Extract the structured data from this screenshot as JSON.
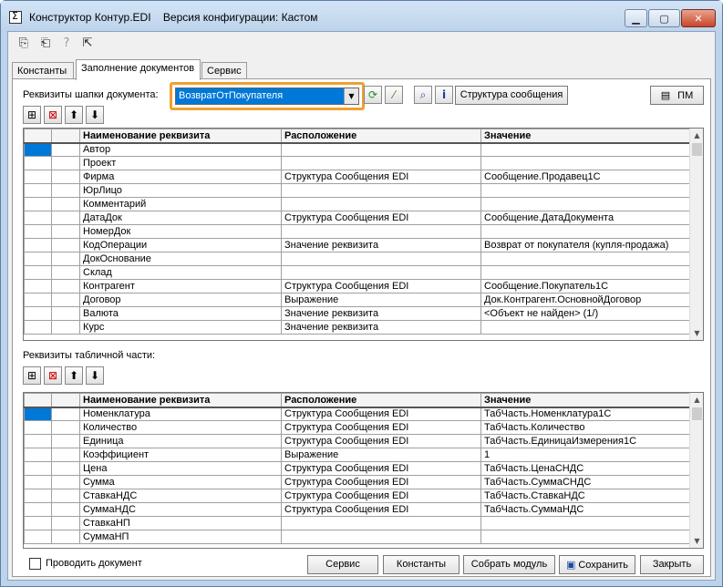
{
  "window": {
    "title": "Конструктор Контур.EDI    Версия конфигурации: Кастом"
  },
  "tabs": [
    {
      "label": "Константы"
    },
    {
      "label": "Заполнение документов"
    },
    {
      "label": "Сервис"
    }
  ],
  "header_section": {
    "label": "Реквизиты шапки документа:",
    "combo_value": "ВозвратОтПокупателя",
    "structure_button": "Структура сообщения",
    "pm_button": "ПМ",
    "columns": [
      "Наименование реквизита",
      "Расположение",
      "Значение"
    ],
    "rows": [
      [
        "Автор",
        "",
        ""
      ],
      [
        "Проект",
        "",
        ""
      ],
      [
        "Фирма",
        "Структура Сообщения EDI",
        "Сообщение.Продавец1С"
      ],
      [
        "ЮрЛицо",
        "",
        ""
      ],
      [
        "Комментарий",
        "",
        ""
      ],
      [
        "ДатаДок",
        "Структура Сообщения EDI",
        "Сообщение.ДатаДокумента"
      ],
      [
        "НомерДок",
        "",
        ""
      ],
      [
        "КодОперации",
        "Значение реквизита",
        "Возврат от покупателя (купля-продажа)"
      ],
      [
        "ДокОснование",
        "",
        ""
      ],
      [
        "Склад",
        "",
        ""
      ],
      [
        "Контрагент",
        "Структура Сообщения EDI",
        "Сообщение.Покупатель1С"
      ],
      [
        "Договор",
        "Выражение",
        "Док.Контрагент.ОсновнойДоговор"
      ],
      [
        "Валюта",
        "Значение реквизита",
        "<Объект не найден> (1/)"
      ],
      [
        "Курс",
        "Значение реквизита",
        ""
      ]
    ]
  },
  "table_section": {
    "label": "Реквизиты табличной части:",
    "columns": [
      "Наименование реквизита",
      "Расположение",
      "Значение"
    ],
    "rows": [
      [
        "Номенклатура",
        "Структура Сообщения EDI",
        "ТабЧасть.Номенклатура1С"
      ],
      [
        "Количество",
        "Структура Сообщения EDI",
        "ТабЧасть.Количество"
      ],
      [
        "Единица",
        "Структура Сообщения EDI",
        "ТабЧасть.ЕдиницаИзмерения1С"
      ],
      [
        "Коэффициент",
        "Выражение",
        "1"
      ],
      [
        "Цена",
        "Структура Сообщения EDI",
        "ТабЧасть.ЦенаСНДС"
      ],
      [
        "Сумма",
        "Структура Сообщения EDI",
        "ТабЧасть.СуммаСНДС"
      ],
      [
        "СтавкаНДС",
        "Структура Сообщения EDI",
        "ТабЧасть.СтавкаНДС"
      ],
      [
        "СуммаНДС",
        "Структура Сообщения EDI",
        "ТабЧасть.СуммаНДС"
      ],
      [
        "СтавкаНП",
        "",
        ""
      ],
      [
        "СуммаНП",
        "",
        ""
      ]
    ]
  },
  "footer": {
    "checkbox_label": "Проводить документ",
    "buttons": [
      "Сервис",
      "Константы",
      "Собрать модуль",
      "Сохранить",
      "Закрыть"
    ]
  },
  "icons": [
    "add-row-icon",
    "delete-row-icon",
    "arrow-up-icon",
    "arrow-down-icon",
    "refresh-icon",
    "wand-icon",
    "search-icon",
    "info-icon",
    "print-icon",
    "save-icon"
  ]
}
